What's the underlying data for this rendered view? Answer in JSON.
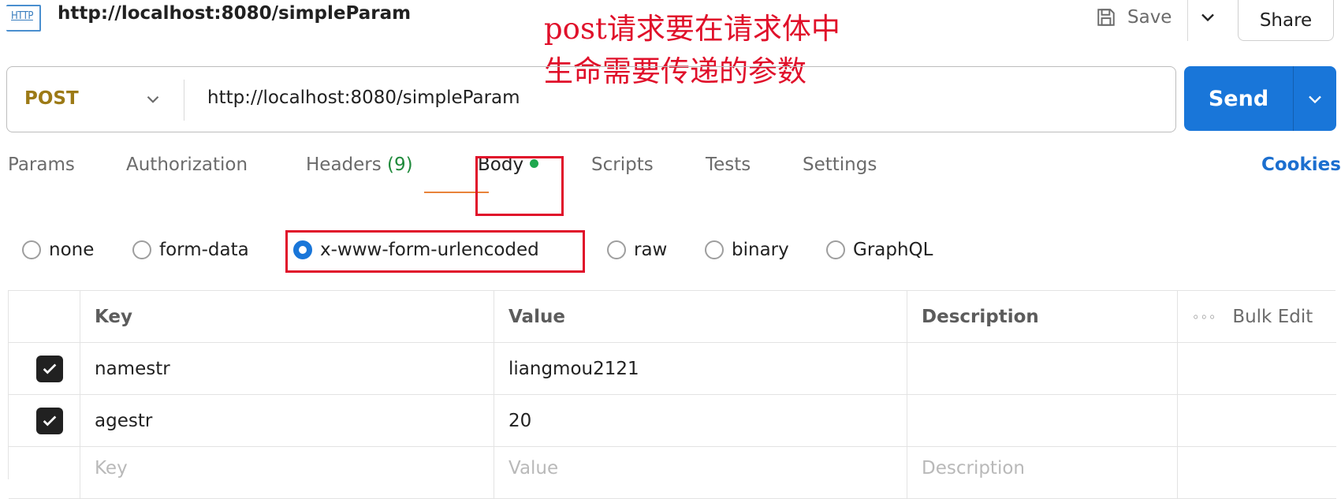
{
  "header": {
    "icon_label": "HTTP",
    "title": "http://localhost:8080/simpleParam",
    "save_label": "Save",
    "share_label": "Share"
  },
  "annotation": {
    "text": "post请求要在请求体中\n生命需要传递的参数",
    "color": "#e0102a"
  },
  "request": {
    "method": "POST",
    "url": "http://localhost:8080/simpleParam",
    "send_label": "Send"
  },
  "tabs": [
    {
      "label": "Params"
    },
    {
      "label": "Authorization"
    },
    {
      "label": "Headers",
      "count": "(9)"
    },
    {
      "label": "Body",
      "active": true,
      "indicator": "green-dot"
    },
    {
      "label": "Scripts"
    },
    {
      "label": "Tests"
    },
    {
      "label": "Settings"
    }
  ],
  "cookies_label": "Cookies",
  "body_types": [
    {
      "label": "none",
      "selected": false
    },
    {
      "label": "form-data",
      "selected": false
    },
    {
      "label": "x-www-form-urlencoded",
      "selected": true
    },
    {
      "label": "raw",
      "selected": false
    },
    {
      "label": "binary",
      "selected": false
    },
    {
      "label": "GraphQL",
      "selected": false
    }
  ],
  "table": {
    "columns": {
      "key": "Key",
      "value": "Value",
      "description": "Description",
      "bulk_edit": "Bulk Edit"
    },
    "rows": [
      {
        "checked": true,
        "key": "namestr",
        "value": "liangmou2121",
        "description": ""
      },
      {
        "checked": true,
        "key": "agestr",
        "value": "20",
        "description": ""
      }
    ],
    "placeholder": {
      "key": "Key",
      "value": "Value",
      "description": "Description"
    }
  },
  "colors": {
    "accent": "#1976d9",
    "method": "#9c7a16",
    "active_indicator": "#1fa84f",
    "highlight_box": "#e0102a"
  }
}
